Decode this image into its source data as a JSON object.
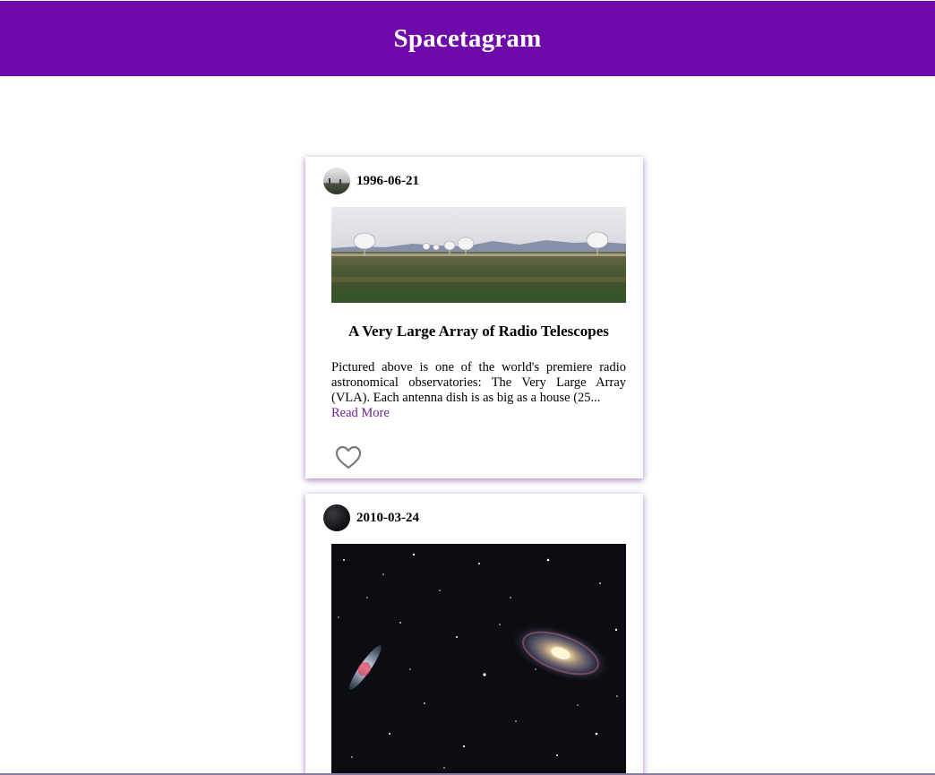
{
  "app": {
    "title": "Spacetagram",
    "accent_color": "#6f0aaa",
    "link_color": "#6f1e9e"
  },
  "posts": [
    {
      "date": "1996-06-21",
      "title": "A Very Large Array of Radio Telescopes",
      "description": "Pictured above is one of the world's premiere radio astronomical observatories: The Very Large Array (VLA). Each antenna dish is as big as a house (25...",
      "read_more_label": "Read More",
      "like_icon": "heart-outline-icon"
    },
    {
      "date": "2010-03-24",
      "like_icon": "heart-outline-icon"
    }
  ]
}
